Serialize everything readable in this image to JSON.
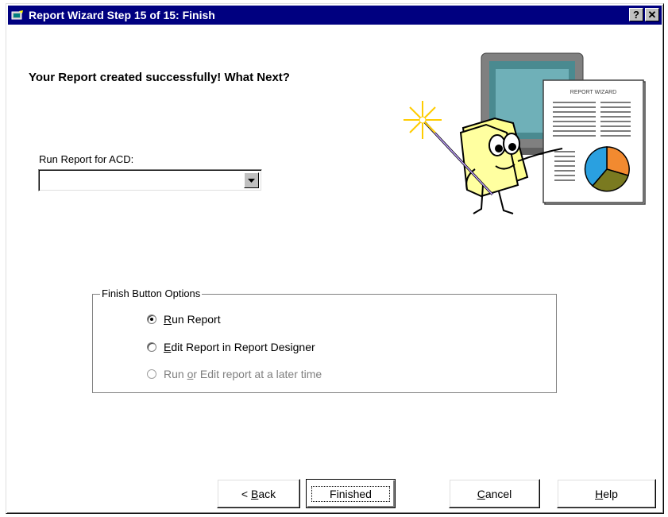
{
  "window": {
    "title": "Report Wizard Step 15 of 15: Finish",
    "help_button": "?",
    "close_button": "✕"
  },
  "heading": "Your Report created successfully!  What Next?",
  "acd": {
    "label": "Run Report for ACD:",
    "value": ""
  },
  "illustration": {
    "document_title": "REPORT WIZARD",
    "icon": "wizard-mascot-with-report"
  },
  "finish_options": {
    "legend": "Finish Button Options",
    "options": [
      {
        "mnemonic": "R",
        "rest": "un Report",
        "selected": true,
        "enabled": true
      },
      {
        "mnemonic": "E",
        "rest": "dit Report in Report Designer",
        "selected": false,
        "enabled": true
      },
      {
        "prefix": "Run ",
        "mnemonic": "o",
        "rest": "r Edit report at a later time",
        "selected": false,
        "enabled": false
      }
    ]
  },
  "buttons": {
    "back": {
      "prefix": "< ",
      "mnemonic": "B",
      "rest": "ack"
    },
    "finished": "Finished",
    "cancel": {
      "mnemonic": "C",
      "rest": "ancel"
    },
    "help": {
      "mnemonic": "H",
      "rest": "elp"
    }
  }
}
